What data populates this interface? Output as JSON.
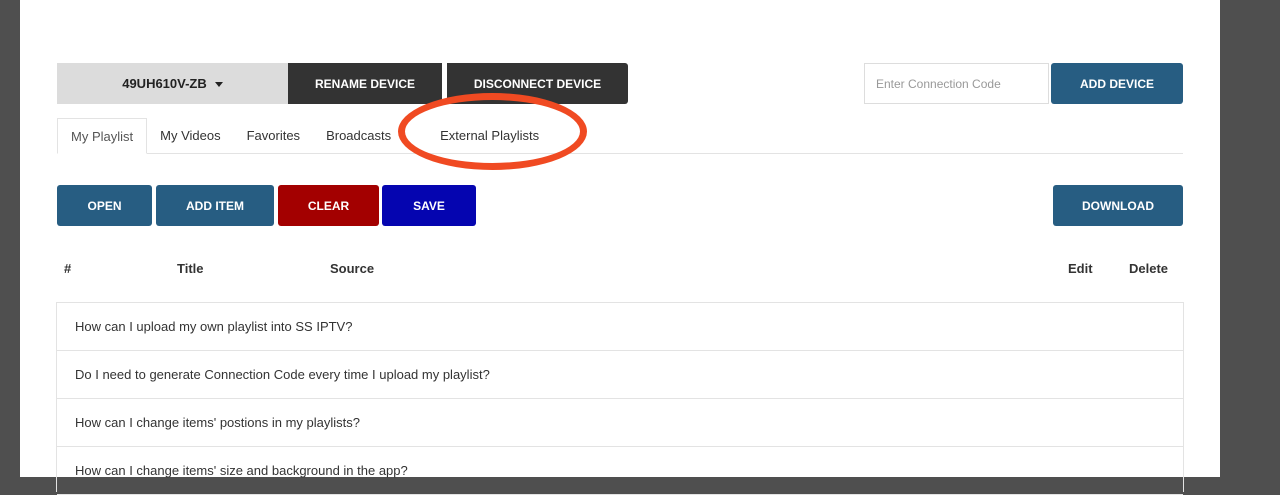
{
  "device": {
    "name": "49UH610V-ZB",
    "rename_label": "RENAME DEVICE",
    "disconnect_label": "DISCONNECT DEVICE"
  },
  "connection": {
    "placeholder": "Enter Connection Code",
    "add_label": "ADD DEVICE"
  },
  "tabs": [
    {
      "label": "My Playlist",
      "active": true
    },
    {
      "label": "My Videos"
    },
    {
      "label": "Favorites"
    },
    {
      "label": "Broadcasts"
    },
    {
      "label": "External Playlists"
    }
  ],
  "toolbar": {
    "open_label": "OPEN",
    "add_item_label": "ADD ITEM",
    "clear_label": "CLEAR",
    "save_label": "SAVE",
    "download_label": "DOWNLOAD"
  },
  "table": {
    "headers": [
      "#",
      "Title",
      "Source",
      "Edit",
      "Delete"
    ]
  },
  "faq": [
    "How can I upload my own playlist into SS IPTV?",
    "Do I need to generate Connection Code every time I upload my playlist?",
    "How can I change items' postions in my playlists?",
    "How can I change items' size and background in the app?"
  ],
  "colors": {
    "primary": "#275d82",
    "danger": "#a30000",
    "save": "#0505b0",
    "dark": "#333333",
    "annotation": "#f04a22"
  }
}
